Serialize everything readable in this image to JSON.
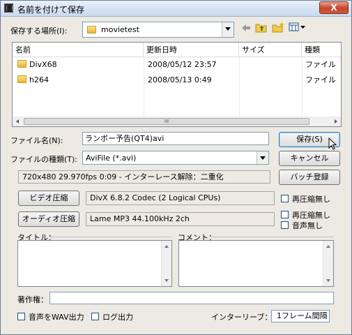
{
  "window": {
    "title": "名前を付けて保存",
    "close_glyph": "X"
  },
  "location": {
    "label": "保存する場所(I):",
    "value": "movietest"
  },
  "file_list": {
    "columns": [
      "名前",
      "更新日時",
      "サイズ",
      "種類"
    ],
    "rows": [
      {
        "name": "DivX68",
        "date": "2008/05/12 23:57",
        "size": "",
        "type": "ファイル"
      },
      {
        "name": "h264",
        "date": "2008/05/13 0:49",
        "size": "",
        "type": "ファイル"
      }
    ],
    "scroll_thumb": "III"
  },
  "filename": {
    "label": "ファイル名(N):",
    "value": "ランボー予告(QT4)avi"
  },
  "filetype": {
    "label": "ファイルの種類(T):",
    "value": "AviFile (*.avi)"
  },
  "buttons": {
    "save": "保存(S)",
    "cancel": "キャンセル",
    "batch": "バッチ登録",
    "video_comp": "ビデオ圧縮",
    "audio_comp": "オーディオ圧縮"
  },
  "info_line": "720x480  29.970fps  0:09  -  インターレース解除：二重化",
  "video_codec": "DivX  6.8.2 Codec (2 Logical CPUs)",
  "audio_codec": "Lame MP3 44.100kHz 2ch",
  "checks": {
    "video_norecomp": "再圧縮無し",
    "audio_norecomp": "再圧縮無し",
    "no_audio": "音声無し",
    "wav_out": "音声をWAV出力",
    "log_out": "ログ出力"
  },
  "title_label": "タイトル：",
  "comment_label": "コメント：",
  "copyright_label": "著作権：",
  "interleave": {
    "label": "インターリーブ：",
    "value": "1フレーム間隔"
  },
  "colors": {
    "window_bg": "#eceae3",
    "close": "#c5442c",
    "folder": "#e9b43a"
  }
}
